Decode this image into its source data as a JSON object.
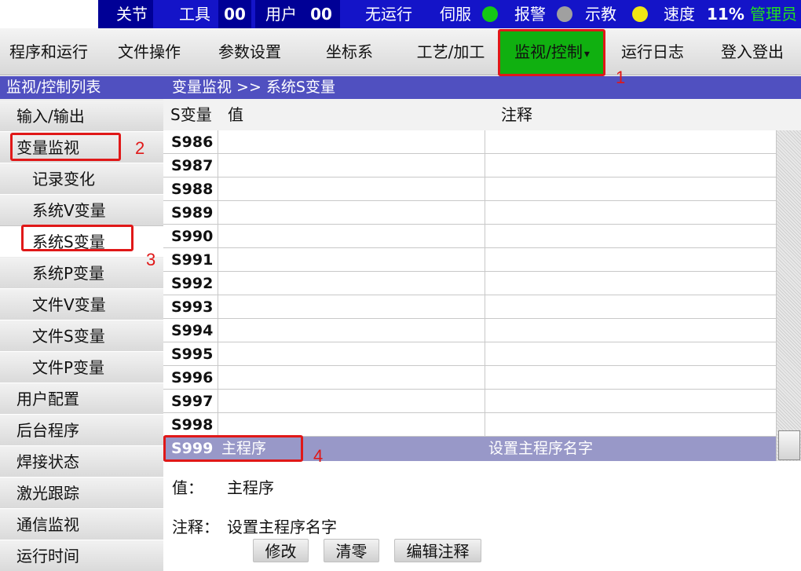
{
  "status_bar": {
    "joint_label": "关节",
    "tool_label": "工具",
    "tool_value": "00",
    "user_label": "用户",
    "user_value": "00",
    "run_status": "无运行",
    "servo_label": "伺服",
    "alarm_label": "报警",
    "teach_label": "示教",
    "speed_label": "速度",
    "speed_value": "11%",
    "role": "管理员",
    "colors": {
      "bar": "#1414c8",
      "servo": "#14c814",
      "alarm": "#a0a0a0",
      "teach": "#f0e614",
      "role": "#20e020"
    }
  },
  "menu": {
    "items": [
      "程序和运行",
      "文件操作",
      "参数设置",
      "坐标系",
      "工艺/加工",
      "监视/控制",
      "运行日志",
      "登入登出"
    ],
    "active": "监视/控制",
    "active_caret": "▾"
  },
  "sidebar": {
    "title": "监视/控制列表",
    "items": [
      "输入/输出",
      "变量监视",
      "记录变化",
      "系统V变量",
      "系统S变量",
      "系统P变量",
      "文件V变量",
      "文件S变量",
      "文件P变量",
      "用户配置",
      "后台程序",
      "焊接状态",
      "激光跟踪",
      "通信监视",
      "运行时间"
    ],
    "selected": "系统S变量"
  },
  "content": {
    "breadcrumb": "变量监视 >> 系统S变量",
    "columns": {
      "name": "S变量",
      "value": "值",
      "note": "注释"
    },
    "rows": [
      {
        "name": "S986",
        "value": "",
        "note": ""
      },
      {
        "name": "S987",
        "value": "",
        "note": ""
      },
      {
        "name": "S988",
        "value": "",
        "note": ""
      },
      {
        "name": "S989",
        "value": "",
        "note": ""
      },
      {
        "name": "S990",
        "value": "",
        "note": ""
      },
      {
        "name": "S991",
        "value": "",
        "note": ""
      },
      {
        "name": "S992",
        "value": "",
        "note": ""
      },
      {
        "name": "S993",
        "value": "",
        "note": ""
      },
      {
        "name": "S994",
        "value": "",
        "note": ""
      },
      {
        "name": "S995",
        "value": "",
        "note": ""
      },
      {
        "name": "S996",
        "value": "",
        "note": ""
      },
      {
        "name": "S997",
        "value": "",
        "note": ""
      },
      {
        "name": "S998",
        "value": "",
        "note": ""
      }
    ],
    "selected_row": {
      "name": "S999",
      "value": "主程序",
      "note": "设置主程序名字"
    }
  },
  "detail": {
    "value_label": "值：",
    "value_text": "主程序",
    "note_label": "注释：",
    "note_text": "设置主程序名字"
  },
  "buttons": {
    "modify": "修改",
    "clear": "清零",
    "edit_note": "编辑注释"
  },
  "annotations": [
    "1",
    "2",
    "3",
    "4"
  ]
}
